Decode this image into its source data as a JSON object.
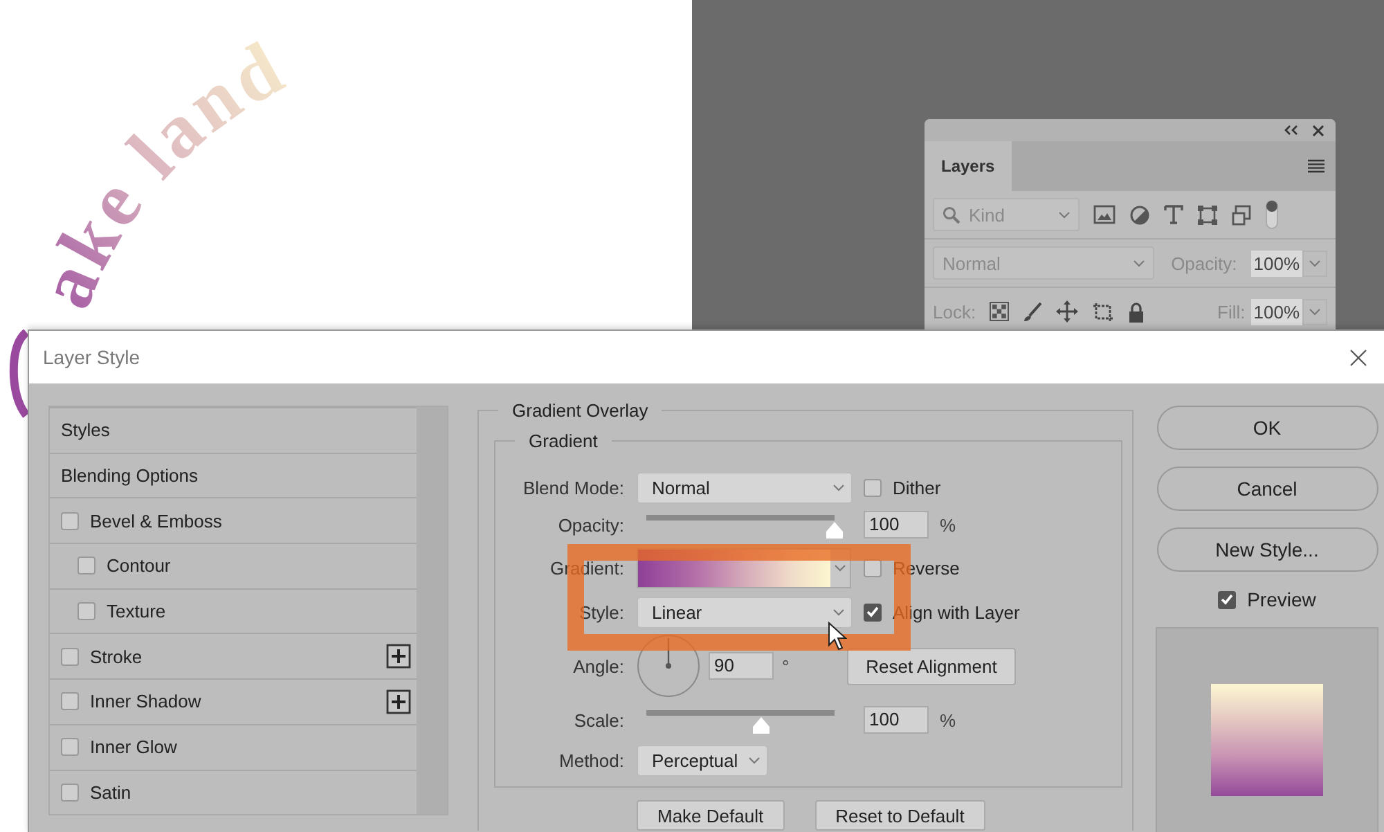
{
  "canvas": {
    "text": "ake land"
  },
  "layers_panel": {
    "tabs": [
      {
        "label": "Layers",
        "selected": true
      }
    ],
    "filter": {
      "value": "Kind"
    },
    "blend_mode": "Normal",
    "opacity_label": "Opacity:",
    "opacity": "100%",
    "lock_label": "Lock:",
    "fill_label": "Fill:",
    "fill": "100%"
  },
  "dialog": {
    "title": "Layer Style",
    "styles_list": [
      {
        "label": "Styles",
        "kind": "header",
        "selected": false
      },
      {
        "label": "Blending Options",
        "kind": "header",
        "selected": false
      },
      {
        "label": "Bevel & Emboss",
        "kind": "effect",
        "checked": false,
        "addable": false,
        "selected": false
      },
      {
        "label": "Contour",
        "kind": "sub",
        "checked": false,
        "addable": false,
        "selected": false
      },
      {
        "label": "Texture",
        "kind": "sub",
        "checked": false,
        "addable": false,
        "selected": false
      },
      {
        "label": "Stroke",
        "kind": "effect",
        "checked": false,
        "addable": true,
        "selected": false
      },
      {
        "label": "Inner Shadow",
        "kind": "effect",
        "checked": false,
        "addable": true,
        "selected": false
      },
      {
        "label": "Inner Glow",
        "kind": "effect",
        "checked": false,
        "addable": false,
        "selected": false
      },
      {
        "label": "Satin",
        "kind": "effect",
        "checked": false,
        "addable": false,
        "selected": false
      }
    ],
    "section_title": "Gradient Overlay",
    "group_title": "Gradient",
    "blend_mode": {
      "label": "Blend Mode:",
      "value": "Normal"
    },
    "dither": {
      "label": "Dither",
      "checked": false
    },
    "opacity": {
      "label": "Opacity:",
      "value": "100",
      "unit": "%",
      "level": 1.0
    },
    "gradient": {
      "label": "Gradient:"
    },
    "reverse": {
      "label": "Reverse",
      "checked": false
    },
    "style": {
      "label": "Style:",
      "value": "Linear"
    },
    "align_with_layer": {
      "label": "Align with Layer",
      "checked": true
    },
    "angle": {
      "label": "Angle:",
      "value": "90",
      "unit": "°"
    },
    "reset_alignment": "Reset Alignment",
    "scale": {
      "label": "Scale:",
      "value": "100",
      "unit": "%",
      "level": 0.61
    },
    "method": {
      "label": "Method:",
      "value": "Perceptual"
    },
    "bottom_buttons": [
      "Make Default",
      "Reset to Default"
    ],
    "side_buttons": [
      "OK",
      "Cancel",
      "New Style..."
    ],
    "preview": {
      "label": "Preview",
      "checked": true
    }
  }
}
